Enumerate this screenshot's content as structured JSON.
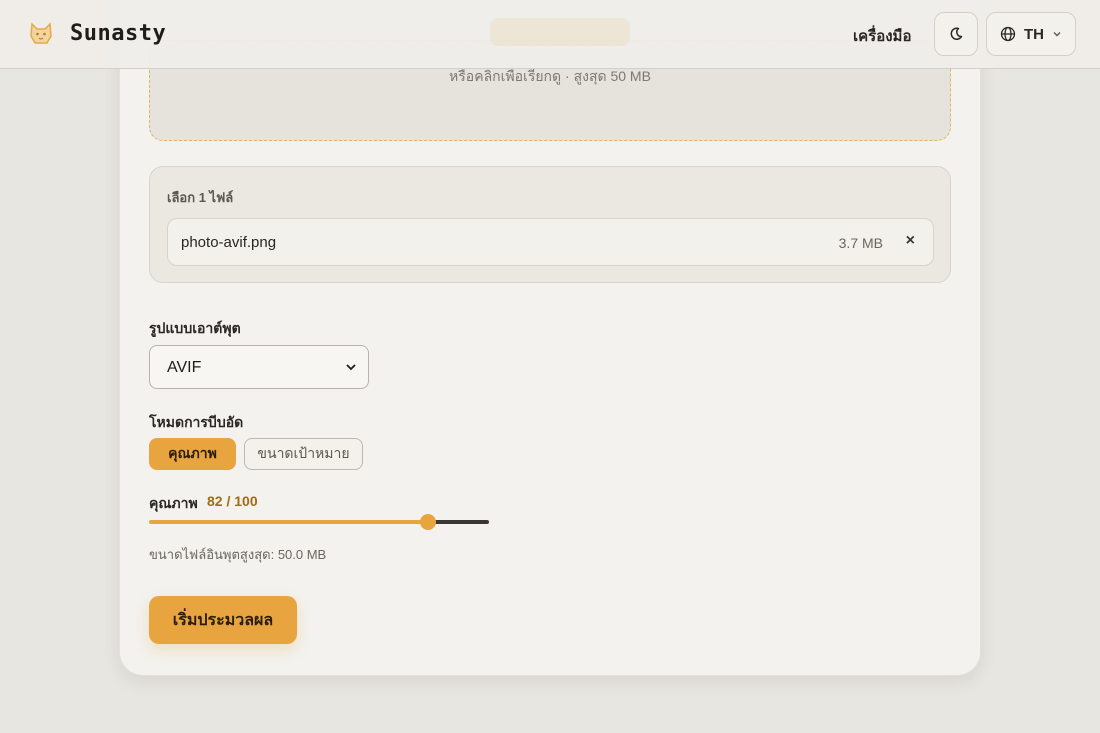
{
  "header": {
    "brand": "Sunasty",
    "tools_link": "เครื่องมือ",
    "language": "TH"
  },
  "dropzone": {
    "hint": "หรือคลิกเพื่อเรียกดู · สูงสุด 50 MB"
  },
  "files": {
    "count_label": "เลือก 1 ไฟล์",
    "items": [
      {
        "name": "photo-avif.png",
        "size": "3.7 MB",
        "remove": "×"
      }
    ]
  },
  "output": {
    "label": "รูปแบบเอาต์พุต",
    "selected": "AVIF"
  },
  "compression": {
    "label": "โหมดการบีบอัด",
    "modes": [
      "คุณภาพ",
      "ขนาดเป้าหมาย"
    ],
    "active_mode": "คุณภาพ"
  },
  "quality": {
    "label": "คุณภาพ",
    "value_text": "82 / 100",
    "value": 82,
    "max": 100
  },
  "max_input_size": "ขนาดไฟล์อินพุตสูงสุด: 50.0 MB",
  "start_button": "เริ่มประมวลผล",
  "colors": {
    "accent": "#e8a53f",
    "background": "#e8e6e1",
    "card": "#f3f2ee"
  },
  "icons": {
    "logo": "cat-logo-icon",
    "theme": "moon-icon",
    "language": "globe-icon",
    "dropdown": "chevron-down-icon",
    "remove": "close-icon"
  }
}
